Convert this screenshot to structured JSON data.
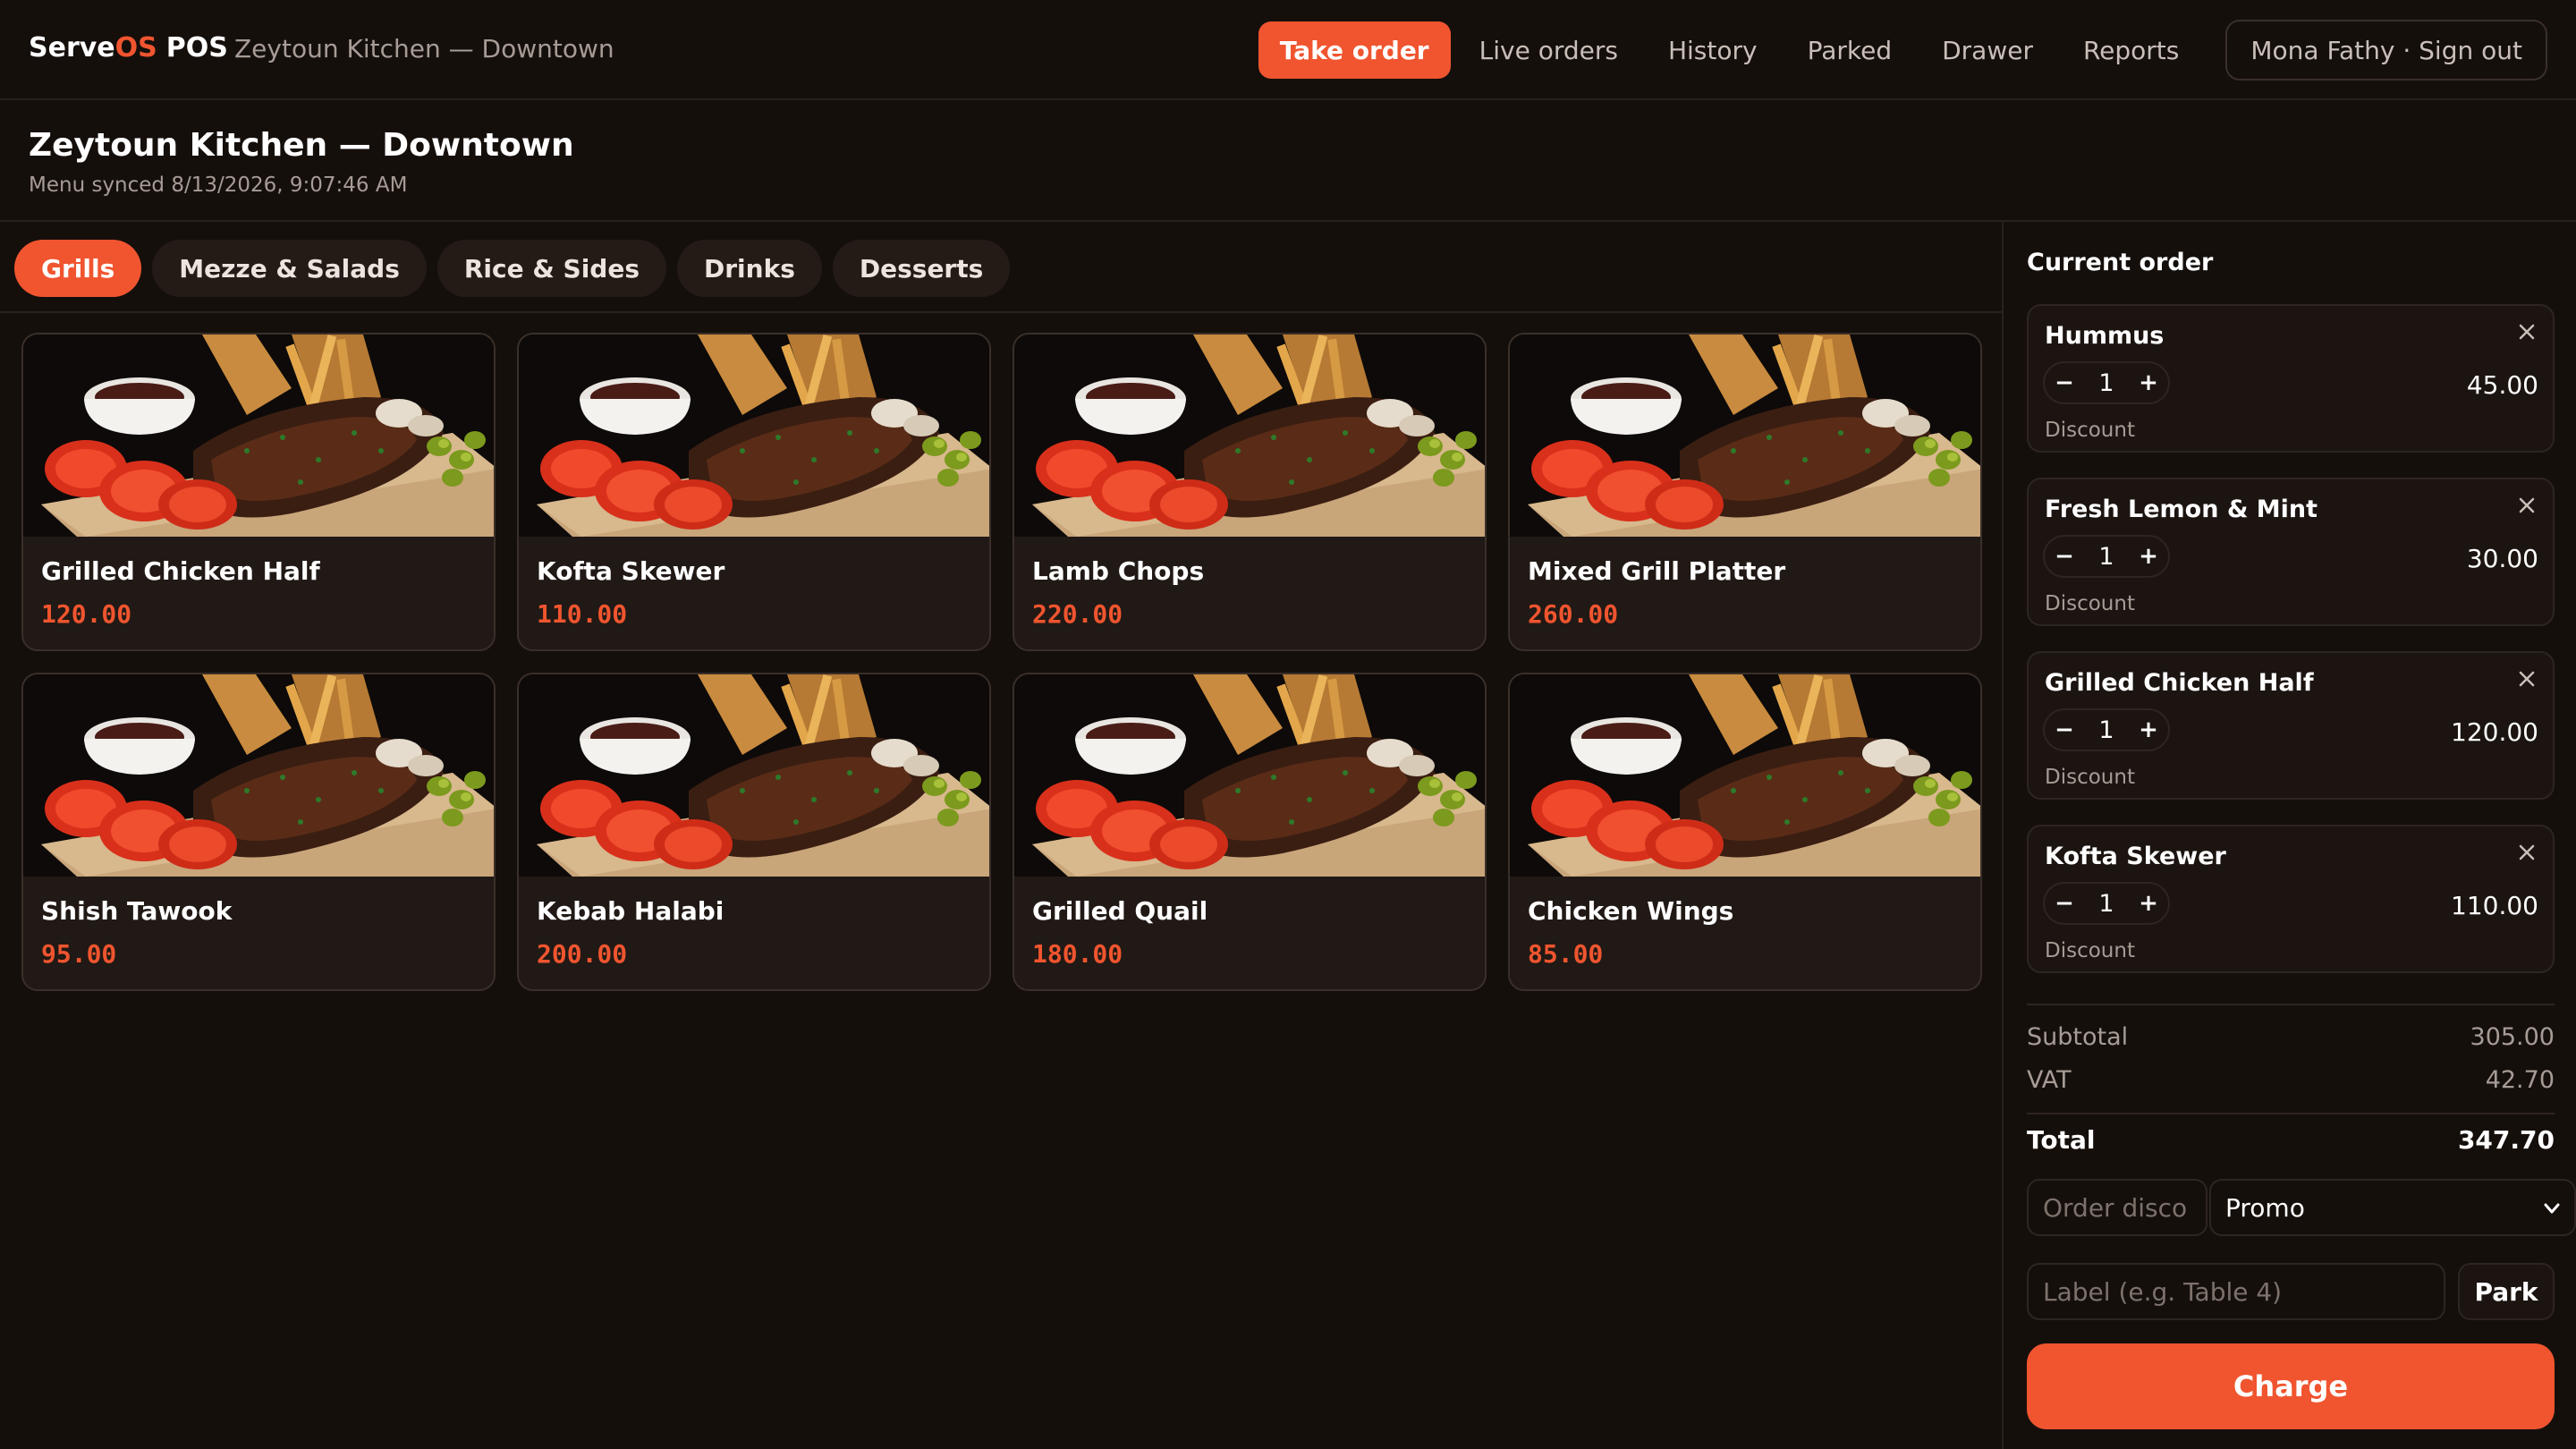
{
  "brand": {
    "part1": "Serve",
    "part2": "OS",
    "part3": "POS"
  },
  "store_subtitle": "Zeytoun Kitchen — Downtown",
  "nav": {
    "take_order": "Take order",
    "live_orders": "Live orders",
    "history": "History",
    "parked": "Parked",
    "drawer": "Drawer",
    "reports": "Reports",
    "user": "Mona Fathy · Sign out"
  },
  "header": {
    "title": "Zeytoun Kitchen — Downtown",
    "sync": "Menu synced 8/13/2026, 9:07:46 AM"
  },
  "categories": [
    "Grills",
    "Mezze & Salads",
    "Rice & Sides",
    "Drinks",
    "Desserts"
  ],
  "active_category": "Grills",
  "menu_items": [
    {
      "name": "Grilled Chicken Half",
      "price": "120.00"
    },
    {
      "name": "Kofta Skewer",
      "price": "110.00"
    },
    {
      "name": "Lamb Chops",
      "price": "220.00"
    },
    {
      "name": "Mixed Grill Platter",
      "price": "260.00"
    },
    {
      "name": "Shish Tawook",
      "price": "95.00"
    },
    {
      "name": "Kebab Halabi",
      "price": "200.00"
    },
    {
      "name": "Grilled Quail",
      "price": "180.00"
    },
    {
      "name": "Chicken Wings",
      "price": "85.00"
    }
  ],
  "order": {
    "title": "Current order",
    "items": [
      {
        "name": "Hummus",
        "qty": "1",
        "price": "45.00",
        "discount": "Discount",
        "minus": "−",
        "plus": "+"
      },
      {
        "name": "Fresh Lemon & Mint",
        "qty": "1",
        "price": "30.00",
        "discount": "Discount",
        "minus": "−",
        "plus": "+"
      },
      {
        "name": "Grilled Chicken Half",
        "qty": "1",
        "price": "120.00",
        "discount": "Discount",
        "minus": "−",
        "plus": "+"
      },
      {
        "name": "Kofta Skewer",
        "qty": "1",
        "price": "110.00",
        "discount": "Discount",
        "minus": "−",
        "plus": "+"
      }
    ],
    "subtotal_label": "Subtotal",
    "subtotal": "305.00",
    "vat_label": "VAT",
    "vat": "42.70",
    "total_label": "Total",
    "total": "347.70",
    "order_discount_placeholder": "Order disco",
    "promo_selected": "Promo",
    "label_placeholder": "Label (e.g. Table 4)",
    "park": "Park",
    "charge": "Charge"
  },
  "colors": {
    "accent": "#f0552f",
    "background": "#150f0c",
    "card": "#211915",
    "muted_text": "#a79c95"
  },
  "icons": {
    "close": "close-icon",
    "select": "chevron-down-icon"
  }
}
